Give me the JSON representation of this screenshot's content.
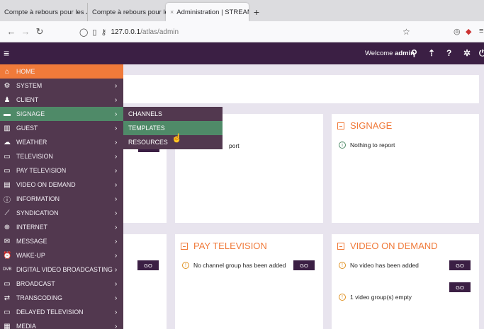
{
  "browser": {
    "tabs": [
      {
        "label": "Compte à rebours pour les J",
        "fade": "(C"
      },
      {
        "label": "Compte à rebours pour les J",
        "fade": "(C"
      },
      {
        "label": "Administration | STREAM",
        "fade": "M"
      }
    ],
    "new_tab": "+",
    "url_host": "127.0.0.1",
    "url_path": "/atlas/admin"
  },
  "header": {
    "welcome_prefix": "Welcome",
    "username": "admin"
  },
  "sidebar": {
    "items": [
      {
        "label": "HOME",
        "icon": "home-icon",
        "glyph": "⌂"
      },
      {
        "label": "SYSTEM",
        "icon": "cogs-icon",
        "glyph": "⚙"
      },
      {
        "label": "CLIENT",
        "icon": "user-icon",
        "glyph": "♟"
      },
      {
        "label": "SIGNAGE",
        "icon": "monitor-icon",
        "glyph": "▬"
      },
      {
        "label": "GUEST",
        "icon": "guest-icon",
        "glyph": "▥"
      },
      {
        "label": "WEATHER",
        "icon": "weather-icon",
        "glyph": "☁"
      },
      {
        "label": "TELEVISION",
        "icon": "television-icon",
        "glyph": "▭"
      },
      {
        "label": "PAY TELEVISION",
        "icon": "pay-television-icon",
        "glyph": "▭"
      },
      {
        "label": "VIDEO ON DEMAND",
        "icon": "video-on-demand-icon",
        "glyph": "▤"
      },
      {
        "label": "INFORMATION",
        "icon": "info-icon",
        "glyph": "ⓘ"
      },
      {
        "label": "SYNDICATION",
        "icon": "rss-icon",
        "glyph": "⟋"
      },
      {
        "label": "INTERNET",
        "icon": "globe-icon",
        "glyph": "⊕"
      },
      {
        "label": "MESSAGE",
        "icon": "envelope-icon",
        "glyph": "✉"
      },
      {
        "label": "WAKE-UP",
        "icon": "alarm-icon",
        "glyph": "⏰"
      },
      {
        "label": "DIGITAL VIDEO BROADCASTING",
        "icon": "dvb-icon",
        "glyph": "DVB"
      },
      {
        "label": "BROADCAST",
        "icon": "broadcast-icon",
        "glyph": "▭"
      },
      {
        "label": "TRANSCODING",
        "icon": "transcoding-icon",
        "glyph": "⇄"
      },
      {
        "label": "DELAYED TELEVISION",
        "icon": "delayed-tv-icon",
        "glyph": "▭"
      },
      {
        "label": "MEDIA",
        "icon": "media-icon",
        "glyph": "▦"
      }
    ],
    "arrow": "›"
  },
  "submenu": {
    "items": [
      "CHANNELS",
      "TEMPLATES",
      "RESOURCES"
    ]
  },
  "panels": {
    "signage": {
      "title": "SIGNAGE",
      "message": "Nothing to report"
    },
    "middle_partial": {
      "message": "port"
    },
    "left_go": "GO",
    "pay_television": {
      "title": "PAY TELEVISION",
      "message": "No channel group has been added",
      "go": "GO"
    },
    "video_on_demand": {
      "title": "VIDEO ON DEMAND",
      "rows": [
        {
          "message": "No video has been added",
          "go": "GO"
        },
        {
          "message": "1 video group(s) empty",
          "go": "GO"
        }
      ]
    }
  },
  "colors": {
    "header": "#3b1f44",
    "sidebar": "#52384f",
    "accent_orange": "#f07a3a",
    "accent_green": "#4f8a68"
  }
}
